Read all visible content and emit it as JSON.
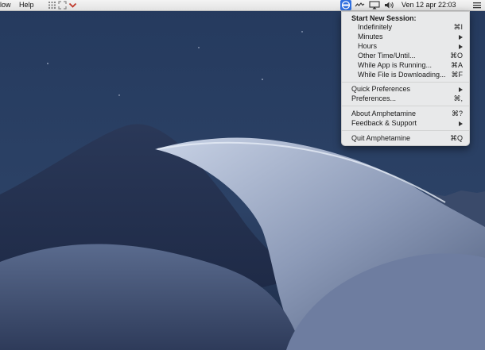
{
  "menubar": {
    "left_menus": [
      "low",
      "Help"
    ],
    "clock": "Ven 12 apr  22:03",
    "icons": [
      "grid-icon",
      "expand-icon",
      "chevron-down-icon",
      "amphetamine-icon",
      "activity-icon",
      "display-icon",
      "volume-icon",
      "list-icon"
    ],
    "accent_color": "#2f6fe0"
  },
  "menu": {
    "header": "Start New Session:",
    "session_items": [
      {
        "label": "Indefinitely",
        "shortcut": "⌘I"
      },
      {
        "label": "Minutes",
        "shortcut": ""
      },
      {
        "label": "Hours",
        "shortcut": ""
      },
      {
        "label": "Other Time/Until...",
        "shortcut": "⌘O"
      },
      {
        "label": "While App is Running...",
        "shortcut": "⌘A"
      },
      {
        "label": "While File is Downloading...",
        "shortcut": "⌘F"
      }
    ],
    "prefs_items": [
      {
        "label": "Quick Preferences",
        "shortcut": ""
      },
      {
        "label": "Preferences...",
        "shortcut": "⌘,"
      }
    ],
    "about_items": [
      {
        "label": "About Amphetamine",
        "shortcut": "⌘?"
      },
      {
        "label": "Feedback & Support",
        "shortcut": ""
      }
    ],
    "quit_item": {
      "label": "Quit Amphetamine",
      "shortcut": "⌘Q"
    }
  }
}
